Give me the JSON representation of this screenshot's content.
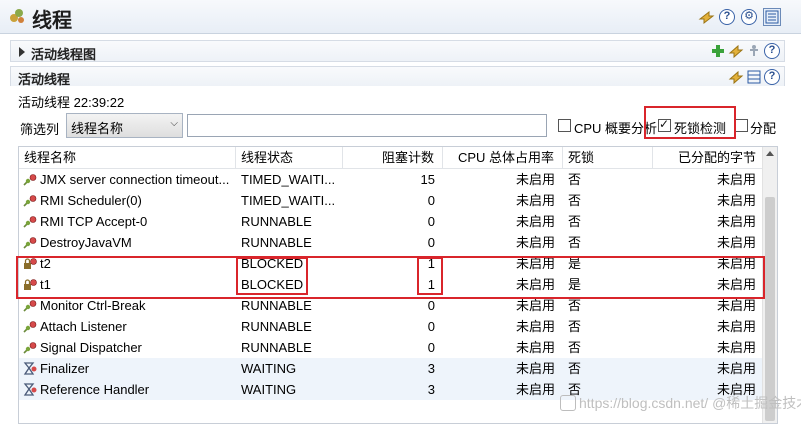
{
  "window": {
    "title": "线程"
  },
  "sections": {
    "graph": {
      "title": "活动线程图"
    },
    "active": {
      "title": "活动线程"
    }
  },
  "active_time": "活动线程 22:39:22",
  "filter": {
    "label": "筛选列",
    "selected": "线程名称",
    "input_value": ""
  },
  "options": [
    {
      "label": "CPU 概要分析",
      "checked": false
    },
    {
      "label": "死锁检测",
      "checked": true
    },
    {
      "label": "分配",
      "checked": false
    }
  ],
  "table": {
    "columns": [
      "线程名称",
      "线程状态",
      "阻塞计数",
      "CPU 总体占用率",
      "死锁",
      "已分配的字节"
    ],
    "rows": [
      {
        "name": "JMX server connection timeout...",
        "state": "TIMED_WAITI...",
        "blocked": "15",
        "cpu": "未启用",
        "deadlock": "否",
        "bytes": "未启用",
        "icon": "running-thread-icon"
      },
      {
        "name": "RMI Scheduler(0)",
        "state": "TIMED_WAITI...",
        "blocked": "0",
        "cpu": "未启用",
        "deadlock": "否",
        "bytes": "未启用",
        "icon": "running-thread-icon"
      },
      {
        "name": "RMI TCP Accept-0",
        "state": "RUNNABLE",
        "blocked": "0",
        "cpu": "未启用",
        "deadlock": "否",
        "bytes": "未启用",
        "icon": "running-thread-icon"
      },
      {
        "name": "DestroyJavaVM",
        "state": "RUNNABLE",
        "blocked": "0",
        "cpu": "未启用",
        "deadlock": "否",
        "bytes": "未启用",
        "icon": "running-thread-icon"
      },
      {
        "name": "t2",
        "state": "BLOCKED",
        "blocked": "1",
        "cpu": "未启用",
        "deadlock": "是",
        "bytes": "未启用",
        "icon": "blocked-thread-icon"
      },
      {
        "name": "t1",
        "state": "BLOCKED",
        "blocked": "1",
        "cpu": "未启用",
        "deadlock": "是",
        "bytes": "未启用",
        "icon": "blocked-thread-icon"
      },
      {
        "name": "Monitor Ctrl-Break",
        "state": "RUNNABLE",
        "blocked": "0",
        "cpu": "未启用",
        "deadlock": "否",
        "bytes": "未启用",
        "icon": "running-thread-icon"
      },
      {
        "name": "Attach Listener",
        "state": "RUNNABLE",
        "blocked": "0",
        "cpu": "未启用",
        "deadlock": "否",
        "bytes": "未启用",
        "icon": "running-thread-icon"
      },
      {
        "name": "Signal Dispatcher",
        "state": "RUNNABLE",
        "blocked": "0",
        "cpu": "未启用",
        "deadlock": "否",
        "bytes": "未启用",
        "icon": "running-thread-icon"
      },
      {
        "name": "Finalizer",
        "state": "WAITING",
        "blocked": "3",
        "cpu": "未启用",
        "deadlock": "否",
        "bytes": "未启用",
        "icon": "waiting-thread-icon"
      },
      {
        "name": "Reference Handler",
        "state": "WAITING",
        "blocked": "3",
        "cpu": "未启用",
        "deadlock": "否",
        "bytes": "未启用",
        "icon": "waiting-thread-icon"
      }
    ]
  },
  "watermark": "https://blog.csdn.net/ @稀土掘金技术社区",
  "colors": {
    "highlight": "#d9252b",
    "accent": "#3a63a8"
  }
}
